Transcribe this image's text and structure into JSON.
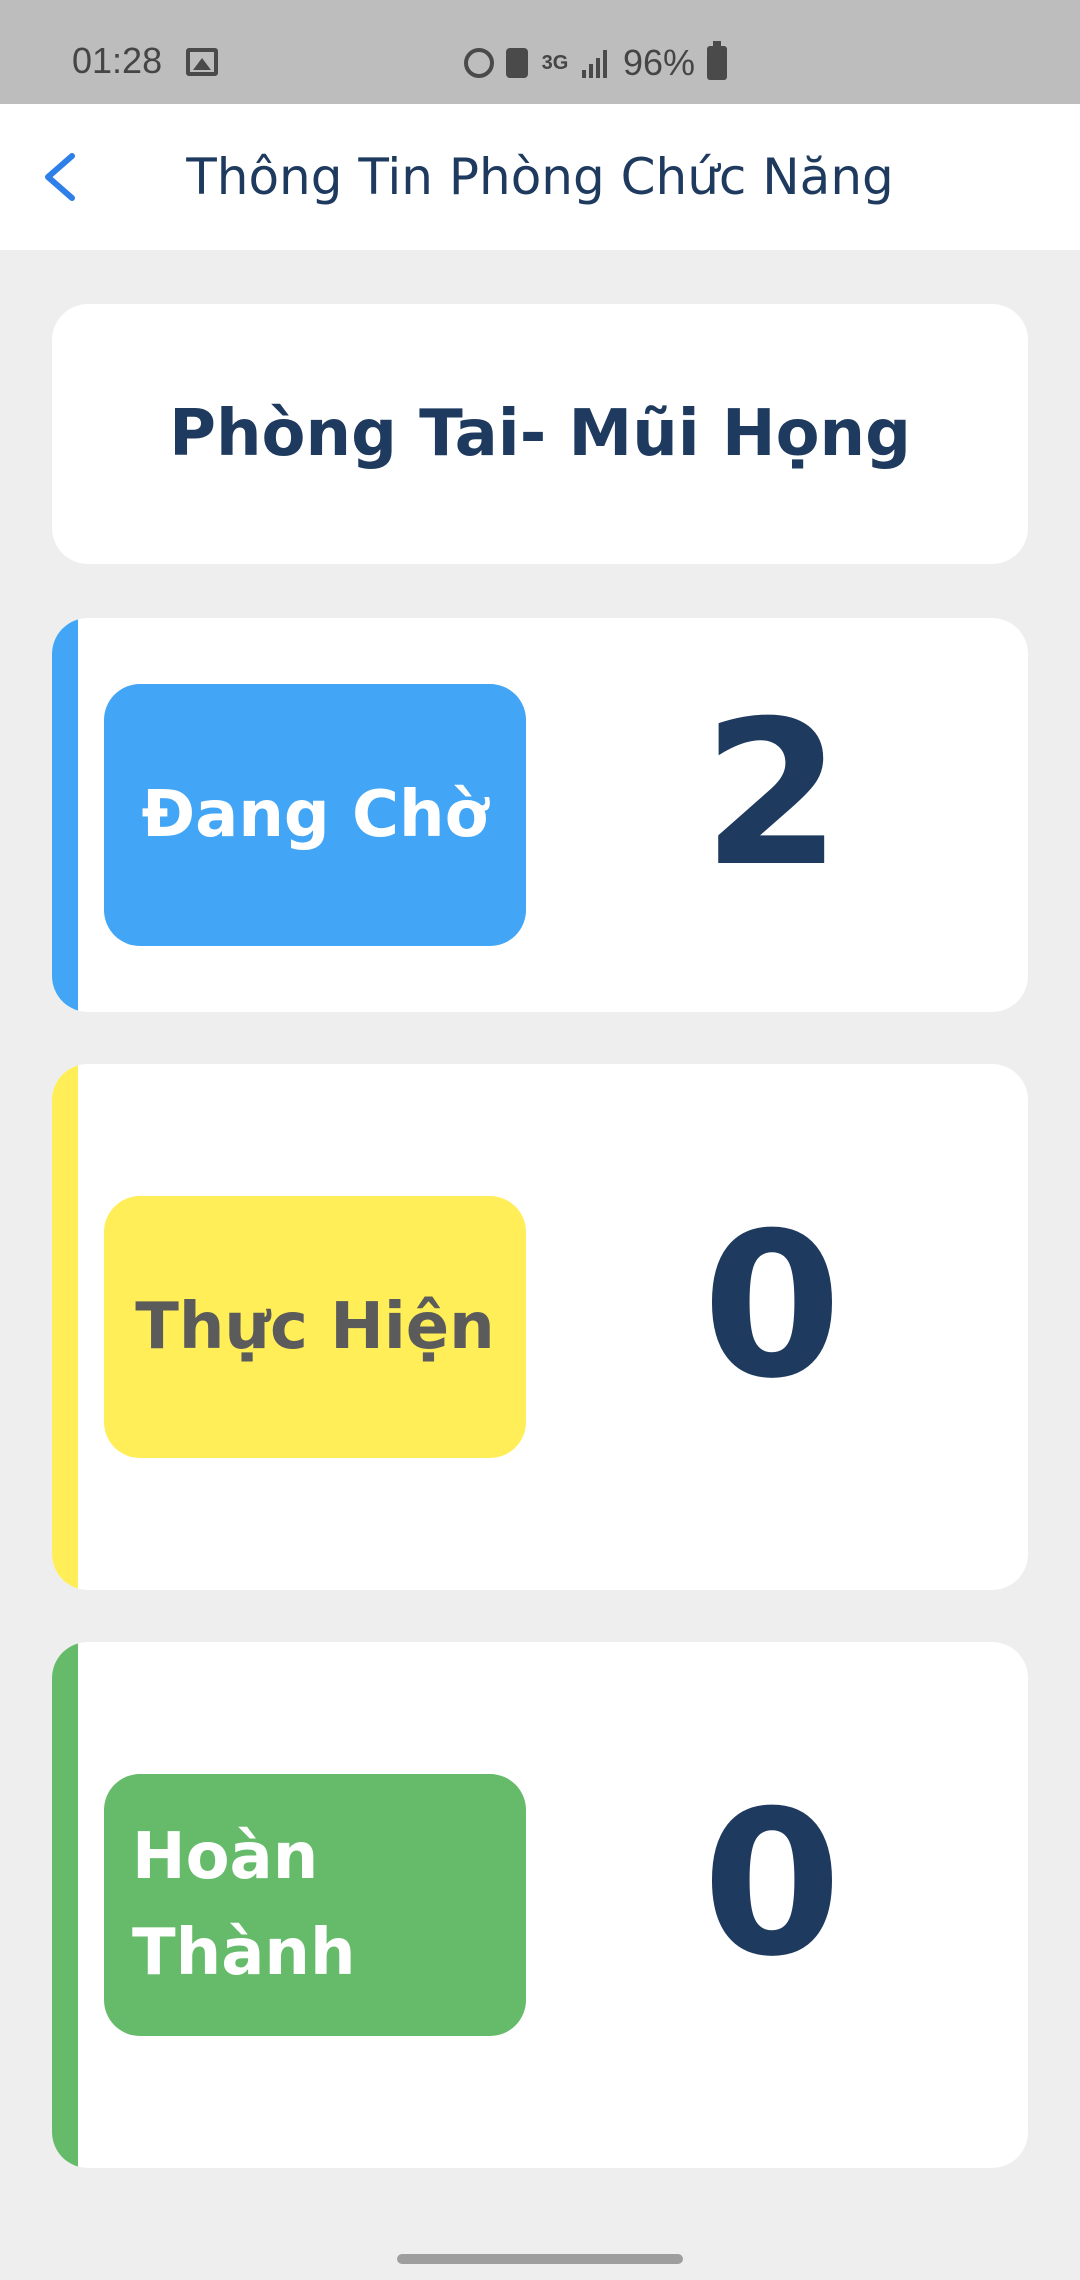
{
  "status_bar": {
    "time": "01:28",
    "network": "3G",
    "battery": "96%",
    "icons": [
      "gallery-icon",
      "alarm-icon",
      "eco-battery-icon",
      "signal-icon",
      "battery-icon"
    ]
  },
  "header": {
    "title": "Thông Tin Phòng Chức Năng",
    "back_icon": "chevron-left-icon",
    "accent_color": "#2f7fe8"
  },
  "room": {
    "name": "Phòng Tai- Mũi Họng"
  },
  "statuses": [
    {
      "label": "Đang Chờ",
      "count": "2",
      "color": "#42a5f5",
      "text_color": "#ffffff"
    },
    {
      "label": "Thực Hiện",
      "count": "0",
      "color": "#ffee58",
      "text_color": "#5b5b5b"
    },
    {
      "label": "Hoàn Thành",
      "count": "0",
      "color": "#66bb6a",
      "text_color": "#ffffff"
    }
  ]
}
